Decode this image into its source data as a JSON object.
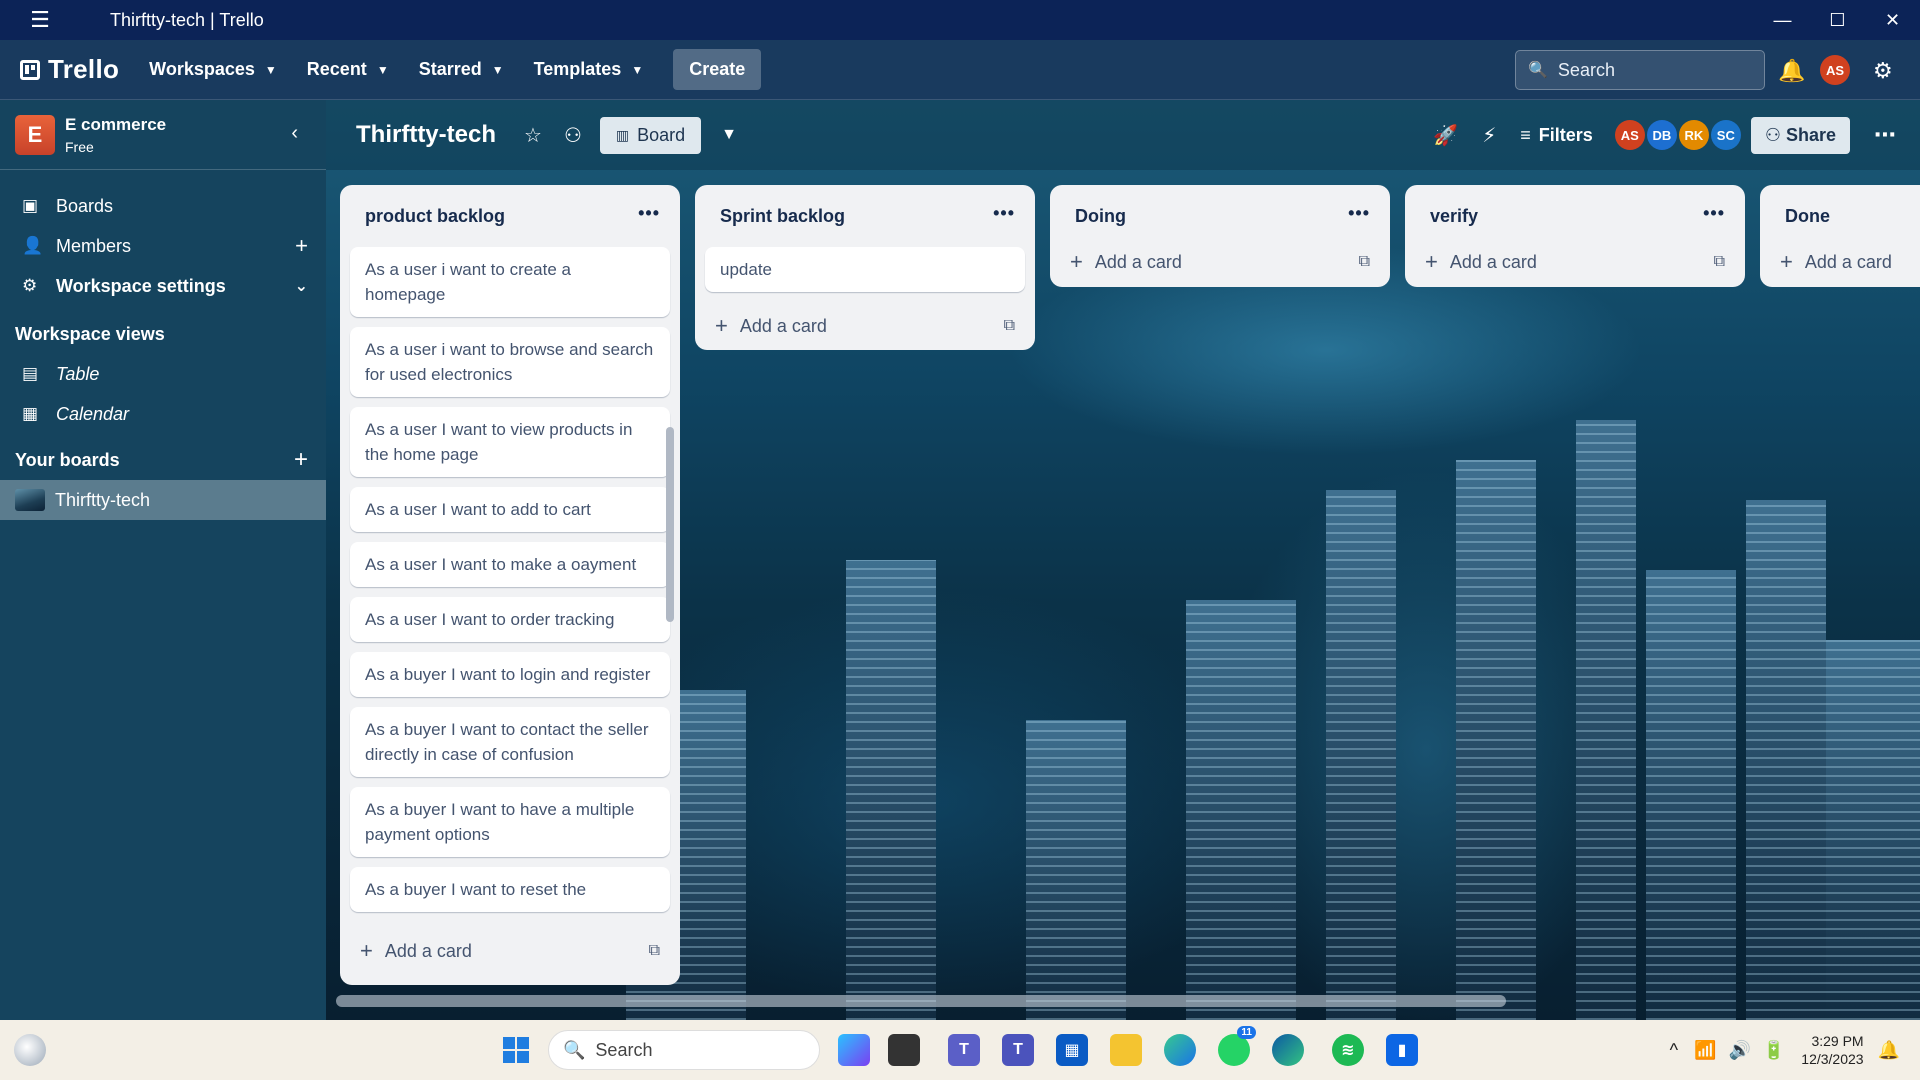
{
  "window": {
    "title": "Thirftty-tech | Trello",
    "menu_icon": "hamburger-icon"
  },
  "nav": {
    "logo": "Trello",
    "items": [
      "Workspaces",
      "Recent",
      "Starred",
      "Templates"
    ],
    "create": "Create",
    "search_placeholder": "Search",
    "user_initials": "AS"
  },
  "sidebar": {
    "workspace_letter": "E",
    "workspace_name": "E commerce",
    "plan": "Free",
    "items": [
      "Boards",
      "Members",
      "Workspace settings"
    ],
    "views_heading": "Workspace views",
    "views": [
      "Table",
      "Calendar"
    ],
    "your_boards_heading": "Your boards",
    "active_board": "Thirftty-tech"
  },
  "board": {
    "title": "Thirftty-tech",
    "view_button": "Board",
    "filters": "Filters",
    "share": "Share",
    "members": [
      {
        "initials": "AS",
        "color": "#d0411f"
      },
      {
        "initials": "DB",
        "color": "#1d6fd1"
      },
      {
        "initials": "RK",
        "color": "#e38a00"
      },
      {
        "initials": "SC",
        "color": "#1a73c9"
      }
    ]
  },
  "lists": [
    {
      "title": "product backlog",
      "cards": [
        "As a user i want to create a homepage",
        "As a user i want to browse and search for used electronics",
        "As a user I want to view products in the home page",
        "As a user I want to add to cart",
        "As a user I want to make a oayment",
        "As a user I want to order tracking",
        "As a buyer I want to login and register",
        "As a buyer I want to contact the seller directly in case of confusion",
        "As a buyer I want to have a multiple payment options",
        "As a buyer I want to reset the"
      ],
      "add": "Add a card"
    },
    {
      "title": "Sprint backlog",
      "cards": [
        "update"
      ],
      "add": "Add a card"
    },
    {
      "title": "Doing",
      "cards": [],
      "add": "Add a card"
    },
    {
      "title": "verify",
      "cards": [],
      "add": "Add a card"
    },
    {
      "title": "Done",
      "cards": [],
      "add": "Add a card"
    }
  ],
  "taskbar": {
    "search": "Search",
    "time": "3:29 PM",
    "date": "12/3/2023",
    "whatsapp_badge": "11"
  }
}
